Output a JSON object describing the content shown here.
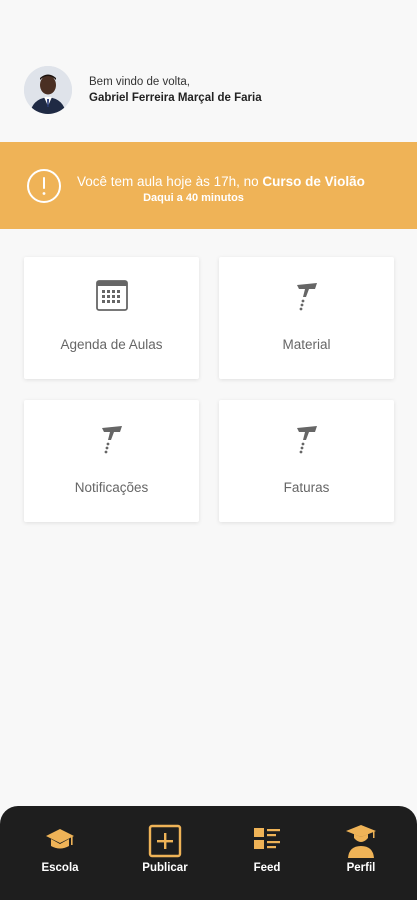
{
  "header": {
    "greeting": "Bem vindo de volta,",
    "user_name": "Gabriel Ferreira Marçal de Faria"
  },
  "banner": {
    "message_prefix": "Você tem aula hoje às 17h, no ",
    "course": "Curso de Violão",
    "subtext": "Daqui a 40 minutos",
    "background": "#efb357"
  },
  "cards": [
    {
      "label": "Agenda de Aulas",
      "icon": "calendar-icon"
    },
    {
      "label": "Material",
      "icon": "placeholder-icon"
    },
    {
      "label": "Notificações",
      "icon": "placeholder-icon"
    },
    {
      "label": "Faturas",
      "icon": "placeholder-icon"
    }
  ],
  "bottom_nav": {
    "items": [
      {
        "label": "Escola",
        "icon": "school-icon"
      },
      {
        "label": "Publicar",
        "icon": "add-square-icon"
      },
      {
        "label": "Feed",
        "icon": "feed-list-icon"
      },
      {
        "label": "Perfil",
        "icon": "graduate-profile-icon"
      }
    ]
  },
  "colors": {
    "accent": "#efb357",
    "nav_background": "#1e1e1e",
    "page_background": "#f8f8f8"
  }
}
